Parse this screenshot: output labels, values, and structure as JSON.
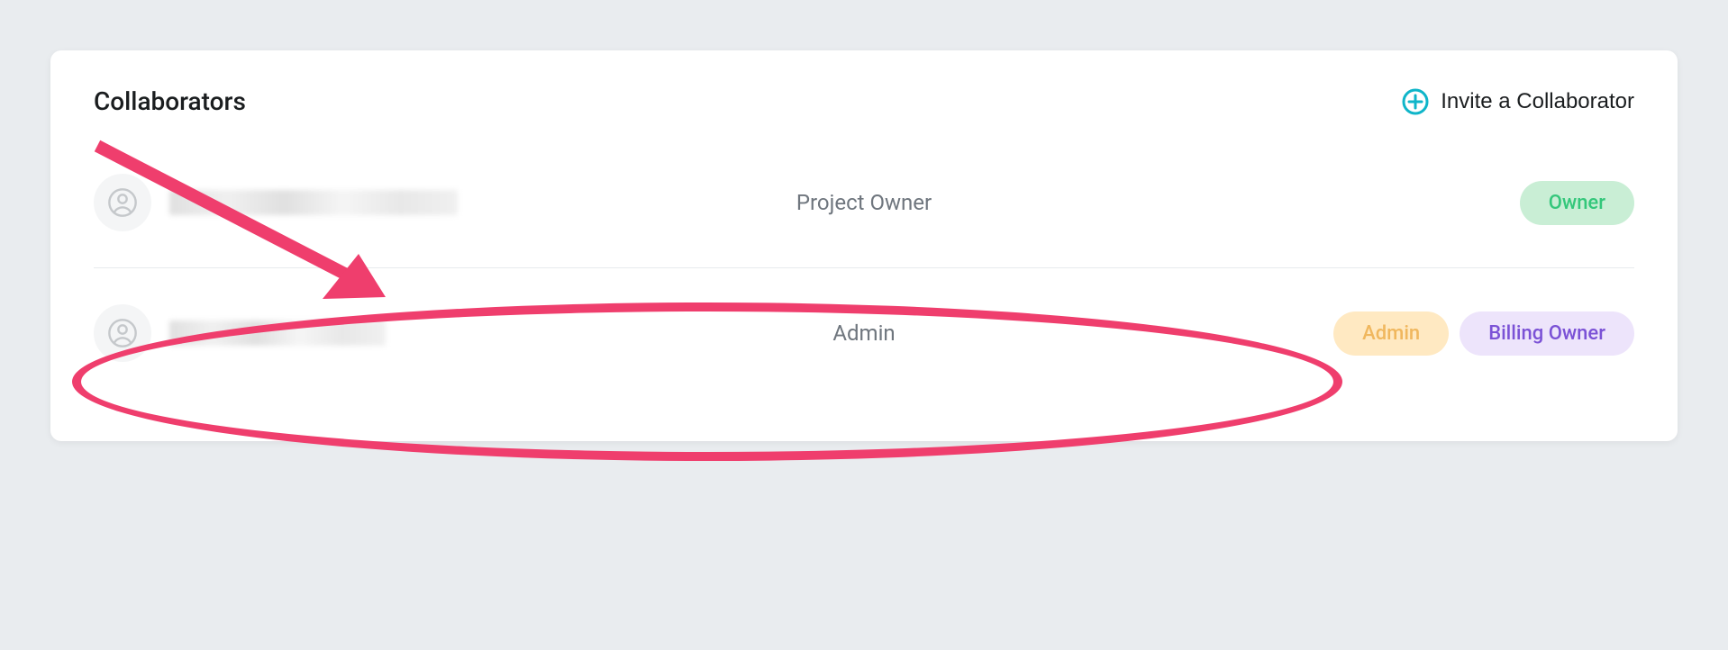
{
  "card": {
    "title": "Collaborators",
    "invite_label": "Invite a Collaborator"
  },
  "collaborators": [
    {
      "role_label": "Project Owner",
      "badges": [
        {
          "text": "Owner",
          "class": "badge-owner"
        }
      ]
    },
    {
      "role_label": "Admin",
      "badges": [
        {
          "text": "Admin",
          "class": "badge-admin"
        },
        {
          "text": "Billing Owner",
          "class": "badge-billing"
        }
      ]
    }
  ],
  "colors": {
    "annotation": "#ef3e6d",
    "accent": "#0fb5c9"
  }
}
